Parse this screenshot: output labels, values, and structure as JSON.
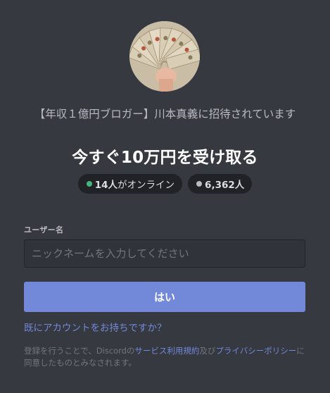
{
  "invite": {
    "inviter_line": "【年収１億円ブロガー】川本真義に招待されています",
    "server_name": "今すぐ10万円を受け取る"
  },
  "stats": {
    "online_count": "14人",
    "online_suffix": "がオンライン",
    "member_count": "6,362人"
  },
  "form": {
    "username_label": "ユーザー名",
    "username_placeholder": "ニックネームを入力してください",
    "username_value": "",
    "submit_label": "はい",
    "login_link": "既にアカウントをお持ちですか？"
  },
  "legal": {
    "prefix": "登録を行うことで、Discordの",
    "terms": "サービス利用規約",
    "middle": "及び",
    "privacy": "プライバシーポリシー",
    "suffix": "に同意したものとみなされます。"
  },
  "colors": {
    "background": "#36393f",
    "accent": "#7289da",
    "online": "#43b581",
    "pill_bg": "#202225"
  },
  "icons": {
    "avatar": "money-fan-avatar",
    "online_dot": "online-status-dot",
    "member_dot": "member-status-dot"
  }
}
